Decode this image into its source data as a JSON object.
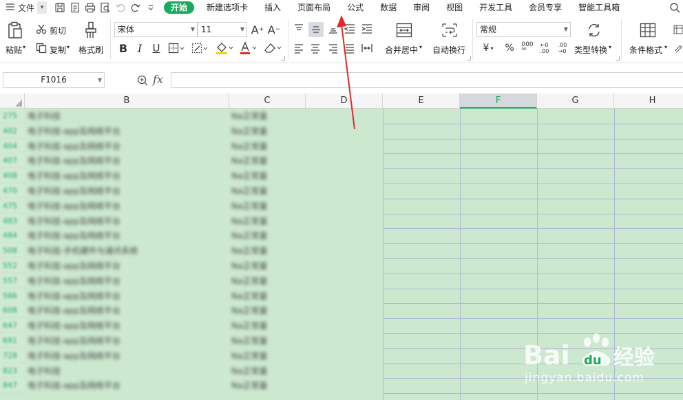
{
  "menubar": {
    "file_label": "文件",
    "tabs": [
      "开始",
      "新建选项卡",
      "插入",
      "页面布局",
      "公式",
      "数据",
      "审阅",
      "视图",
      "开发工具",
      "会员专享",
      "智能工具箱"
    ],
    "active_tab": "开始"
  },
  "ribbon": {
    "paste": "粘贴",
    "cut": "剪切",
    "copy": "复制",
    "format_painter": "格式刷",
    "font_name": "宋体",
    "font_size": "11",
    "merge_center": "合并居中",
    "wrap_text": "自动换行",
    "number_format": "常规",
    "type_convert": "类型转换",
    "conditional_format": "条件格式"
  },
  "formula_bar": {
    "name_box": "F1016",
    "fx": "fx",
    "formula": ""
  },
  "grid": {
    "column_headers": [
      "B",
      "C",
      "D",
      "E",
      "F",
      "G",
      "H"
    ],
    "selected_column": "F",
    "rows": [
      {
        "num": "275",
        "b": "电子科技",
        "c": "Na正常量"
      },
      {
        "num": "402",
        "b": "电子科技-app及网络平台",
        "c": "Na正常量"
      },
      {
        "num": "404",
        "b": "电子科技-app及网络平台",
        "c": "Na正常量"
      },
      {
        "num": "407",
        "b": "电子科技-app及网络平台",
        "c": "Na正常量"
      },
      {
        "num": "408",
        "b": "电子科技-app及网络平台",
        "c": "Na正常量"
      },
      {
        "num": "470",
        "b": "电子科技-app及网络平台",
        "c": "Na正常量"
      },
      {
        "num": "475",
        "b": "电子科技-app及网络平台",
        "c": "Na正常量"
      },
      {
        "num": "483",
        "b": "电子科技-app及网络平台",
        "c": "Na正常量"
      },
      {
        "num": "484",
        "b": "电子科技-app及网络平台",
        "c": "Na正常量"
      },
      {
        "num": "508",
        "b": "电子科技-手机硬件与通讯系统",
        "c": "Na正常量"
      },
      {
        "num": "552",
        "b": "电子科技-app及网络平台",
        "c": "Na正常量"
      },
      {
        "num": "557",
        "b": "电子科技-app及网络平台",
        "c": "Na正常量"
      },
      {
        "num": "586",
        "b": "电子科技-app及网络平台",
        "c": "Na正常量"
      },
      {
        "num": "608",
        "b": "电子科技-app及网络平台",
        "c": "Na正常量"
      },
      {
        "num": "647",
        "b": "电子科技-app及网络平台",
        "c": "Na正常量"
      },
      {
        "num": "691",
        "b": "电子科技-app及网络平台",
        "c": "Na正常量"
      },
      {
        "num": "728",
        "b": "电子科技-app及网络平台",
        "c": "Na正常量"
      },
      {
        "num": "823",
        "b": "电子科技",
        "c": "Na正常量"
      },
      {
        "num": "847",
        "b": "电子科技-app及网络平台",
        "c": "Na正常量"
      }
    ]
  },
  "watermark": {
    "brand": "Bai du 经验",
    "url": "jingyan.baidu.com"
  },
  "colors": {
    "accent": "#1aaa5f",
    "cell_background": "#cce8cf",
    "annotation_arrow": "#e0282e"
  }
}
